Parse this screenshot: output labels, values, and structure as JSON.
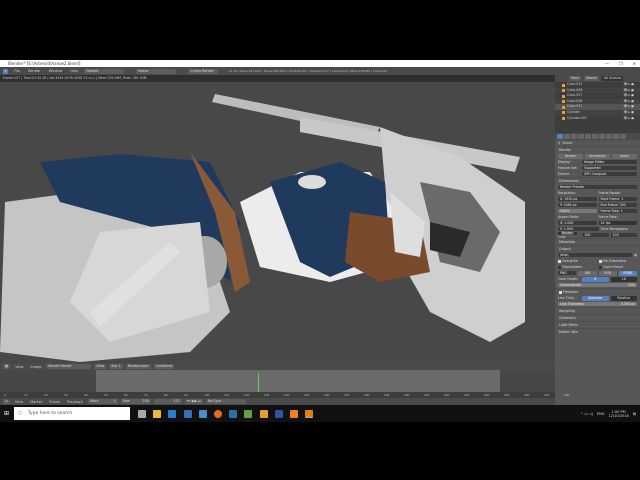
{
  "window": {
    "title": "Blender* [E:\\Asteroid\\Aarow2.blend]",
    "minimize": "—",
    "maximize": "❐",
    "close": "✕"
  },
  "menubar": {
    "menus": [
      "File",
      "Render",
      "Window",
      "Help"
    ],
    "layout": "Default",
    "scene": "Scene",
    "engine": "Cycles Render",
    "stats": "v2.79 | Verts:307,020 | Faces:584,540 | Tris:618,912 | Objects:1/37 | Lamps:0/3 | Mem:245.8M | Cube.031"
  },
  "info": "Frame:127 | Time:01:32.28 | Vol:4494 49 Pk:5818 72 Ls:1 | Mem:139.29M, Peak: 281.54M",
  "outliner": {
    "tabs": [
      "View",
      "Search",
      "All Scenes"
    ],
    "items": [
      "Cube.024",
      "Cube.026",
      "Cube.027",
      "Cube.028",
      "Cube.031",
      "Cylinder",
      "Cylinder.001"
    ]
  },
  "properties": {
    "breadcrumb": "Scene",
    "render_section": "Render",
    "render_buttons": [
      "Render",
      "Animation",
      "Audio"
    ],
    "display_label": "Display:",
    "display_value": "Image Editor",
    "featureset_label": "Feature Set:",
    "featureset_value": "Supported",
    "device_label": "Device:",
    "device_value": "GPU Compute",
    "dimensions_section": "Dimensions",
    "presets": "Render Presets",
    "resolution_label": "Resolution:",
    "res_x": "X: 1920 px",
    "res_y": "Y: 1080 px",
    "res_pct": "100%",
    "frame_range_label": "Frame Range:",
    "start_frame": "Start Frame: 1",
    "end_frame": "End Frame: 250",
    "frame_step": "Frame Step: 1",
    "aspect_label": "Aspect Ratio:",
    "aspect_x": "X: 1.000",
    "aspect_y": "Y: 1.000",
    "framerate_label": "Frame Rate:",
    "framerate": "24 fps",
    "remap_label": "Time Remapping:",
    "remap_old": "100",
    "remap_new": "100",
    "border": "Border",
    "crop": "Crop",
    "metadata_section": "Metadata",
    "output_section": "Output",
    "output_path": "/tmp\\",
    "overwrite": "Overwrite",
    "file_ext": "File Extensions",
    "placeholders": "Placeholders",
    "cache_result": "Cache Result",
    "format": "PNG",
    "bw": "BW",
    "rgb": "RGB",
    "rgba": "RGBA",
    "color_depth_label": "Color Depth:",
    "depth_8": "8",
    "depth_16": "16",
    "compression": "Compression:",
    "compression_value": "15%",
    "freestyle_section": "Freestyle",
    "line_thickness_label": "Line Thick...",
    "absolute": "Absolute",
    "relative": "Relative",
    "line_thickness": "Line Thickness:",
    "line_thickness_value": "0.500 px",
    "sampling": "Sampling",
    "geometry": "Geometry",
    "light_paths": "Light Paths",
    "motion_blur": "Motion Blur"
  },
  "image_editor": {
    "menus": [
      "View",
      "Image"
    ],
    "image": "Render Result",
    "view": "View",
    "slot": "Slot 1",
    "layer": "RenderLayer",
    "pass": "Combined"
  },
  "timeline": {
    "ticks": [
      "0",
      "10",
      "20",
      "30",
      "40",
      "50",
      "60",
      "70",
      "80",
      "90",
      "100",
      "110",
      "120",
      "130",
      "140",
      "150",
      "160",
      "170",
      "180",
      "190",
      "200",
      "210",
      "220",
      "230",
      "240",
      "250",
      "260",
      "270",
      "280"
    ],
    "current_frame": 127,
    "menus": [
      "View",
      "Marker",
      "Frame",
      "Playback"
    ],
    "start": "Start:",
    "start_value": "1",
    "end": "End:",
    "end_value": "250",
    "frame": "127",
    "sync": "No Sync"
  },
  "taskbar": {
    "search_placeholder": "Type here to search",
    "time": "1:50 PM",
    "date": "12/10/2018",
    "lang": "ENG"
  },
  "colors": {
    "accent": "#5680c2",
    "playhead": "#5fcf4f",
    "model_blue": "#1f3a5c"
  }
}
